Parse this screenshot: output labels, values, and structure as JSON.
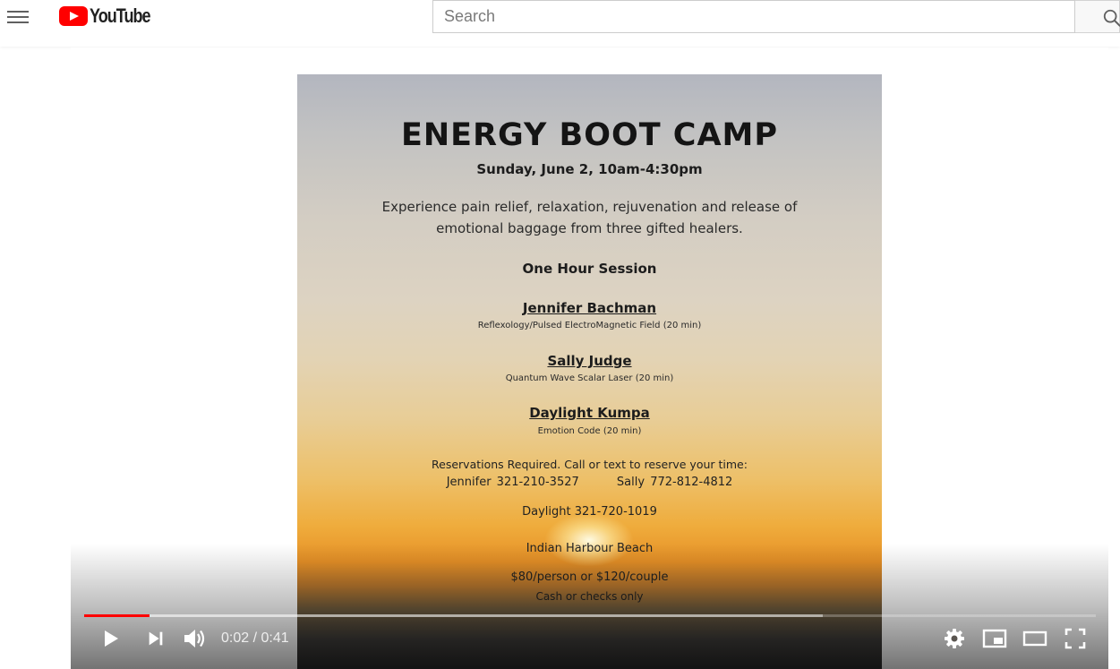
{
  "masthead": {
    "logo_text": "YouTube",
    "search_placeholder": "Search",
    "icons": [
      "menu-icon",
      "youtube-logo-icon",
      "search-icon"
    ]
  },
  "video": {
    "flyer": {
      "title": "ENERGY BOOT CAMP",
      "date": "Sunday, June 2, 10am-4:30pm",
      "description_line1": "Experience pain relief, relaxation, rejuvenation and release of",
      "description_line2": "emotional baggage from three gifted healers.",
      "session": "One Hour Session",
      "healers": [
        {
          "name": "Jennifer Bachman",
          "detail": "Reflexology/Pulsed ElectroMagnetic Field (20 min)"
        },
        {
          "name": "Sally Judge",
          "detail": "Quantum Wave Scalar Laser (20 min)"
        },
        {
          "name": "Daylight Kumpa",
          "detail": "Emotion Code (20 min)"
        }
      ],
      "reservations": "Reservations Required. Call or text to reserve your time:",
      "phone_jennifer": "Jennifer 321-210-3527",
      "phone_sally": "Sally 772-812-4812",
      "phone_daylight": "Daylight 321-720-1019",
      "location": "Indian Harbour Beach",
      "price": "$80/person or $120/couple",
      "payment": "Cash or checks only"
    }
  },
  "player": {
    "time_display": "0:02 / 0:41",
    "played_fraction": 0.065,
    "loaded_fraction": 0.73,
    "colors": {
      "progress": "#ff0000",
      "logo": "#ff0000"
    },
    "control_icons": [
      "play-icon",
      "next-icon",
      "volume-icon",
      "settings-icon",
      "miniplayer-icon",
      "theater-icon",
      "fullscreen-icon"
    ]
  }
}
